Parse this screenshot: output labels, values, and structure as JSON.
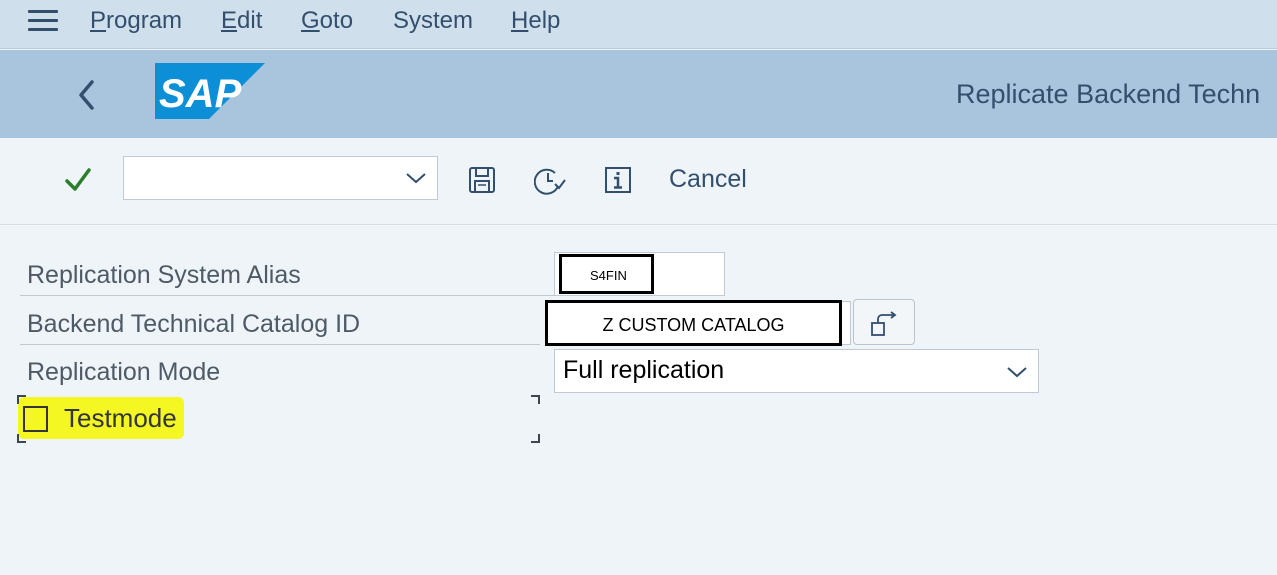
{
  "menu": {
    "items": [
      {
        "accel": "P",
        "rest": "rogram"
      },
      {
        "accel": "E",
        "rest": "dit"
      },
      {
        "accel": "G",
        "rest": "oto"
      },
      {
        "accel": "",
        "rest": "System"
      },
      {
        "accel": "H",
        "rest": "elp"
      }
    ]
  },
  "header": {
    "logo_text": "SAP",
    "title": "Replicate Backend Techn"
  },
  "toolbar": {
    "command_value": "",
    "cancel_label": "Cancel"
  },
  "form": {
    "alias_label": "Replication System Alias",
    "alias_value": "S4FIN",
    "catalog_label": "Backend Technical Catalog ID",
    "catalog_value": "Z  CUSTOM  CATALOG",
    "mode_label": "Replication Mode",
    "mode_value": "Full replication",
    "testmode_label": "Testmode",
    "testmode_checked": false
  },
  "colors": {
    "menu_bg": "#d0dfec",
    "shell_bg": "#a9c5de",
    "page_bg": "#eff4f9",
    "highlight": "#f4f722",
    "accent": "#32506e",
    "check_green": "#2b7d2b",
    "logo_blue": "#0d8fd8"
  }
}
